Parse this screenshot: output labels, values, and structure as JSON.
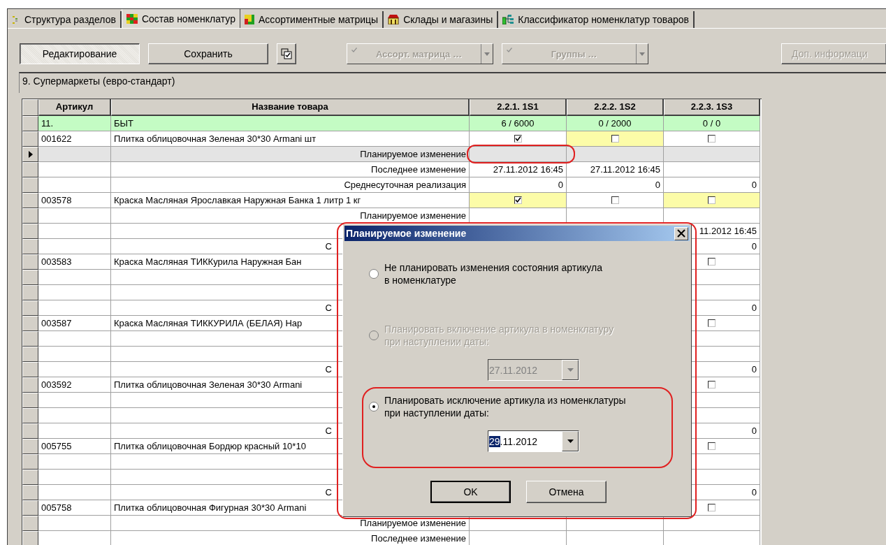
{
  "tabs": [
    {
      "label": "Структура разделов",
      "selected": false
    },
    {
      "label": "Состав номенклатур",
      "selected": true
    },
    {
      "label": "Ассортиментные матрицы",
      "selected": false
    },
    {
      "label": "Склады и магазины",
      "selected": false
    },
    {
      "label": "Классификатор номенклатур товаров",
      "selected": false
    }
  ],
  "toolbar": [
    {
      "kind": "toggle",
      "label": "Редактирование",
      "pressed": true
    },
    {
      "kind": "button",
      "label": "Сохранить",
      "disabled": false
    },
    {
      "kind": "icon"
    },
    {
      "kind": "dropdown",
      "label": "Ассорт. матрица …",
      "disabled": true
    },
    {
      "kind": "dropdown",
      "label": "Группы …",
      "disabled": true
    },
    {
      "kind": "button",
      "label": "Доп. информаци",
      "disabled": true
    }
  ],
  "breadcrumb": "9. Супермаркеты (евро-стандарт)",
  "table": {
    "columns": [
      "",
      "Артикул",
      "Название товара",
      "2.2.1. 1S1",
      "2.2.2. 1S2",
      "2.2.3. 1S3"
    ],
    "rows": [
      {
        "kind": "group",
        "selected": false,
        "cells": [
          null,
          {
            "text": "11."
          },
          {
            "text": "БЫТ"
          },
          {
            "text": "6 / 6000"
          },
          {
            "text": "0 / 2000"
          },
          {
            "text": "0 / 0"
          }
        ]
      },
      {
        "kind": "item",
        "selected": false,
        "cells": [
          null,
          {
            "text": "001622"
          },
          {
            "text": "Плитка облицовочная Зеленая 30*30 Armani шт"
          },
          {
            "checked": true,
            "highlighted": false
          },
          {
            "checked": false,
            "highlighted": true
          },
          {
            "checked": false,
            "highlighted": false
          }
        ]
      },
      {
        "kind": "detail",
        "selected": true,
        "cells": [
          null,
          null,
          {
            "text": "Планируемое изменение"
          },
          null,
          null,
          null
        ]
      },
      {
        "kind": "detail",
        "selected": false,
        "cells": [
          null,
          null,
          {
            "text": "Последнее изменение"
          },
          {
            "text": "27.11.2012 16:45"
          },
          {
            "text": "27.11.2012 16:45"
          },
          null
        ]
      },
      {
        "kind": "detail",
        "selected": false,
        "cells": [
          null,
          null,
          {
            "text": "Среднесуточная реализация"
          },
          {
            "text": "0"
          },
          {
            "text": "0"
          },
          {
            "text": "0"
          }
        ]
      },
      {
        "kind": "item",
        "selected": false,
        "cells": [
          null,
          {
            "text": "003578"
          },
          {
            "text": "Краска Масляная Ярославкая Наружная Банка 1 литр 1 кг"
          },
          {
            "checked": true,
            "highlighted": true
          },
          {
            "checked": false,
            "highlighted": false
          },
          {
            "checked": false,
            "highlighted": true
          }
        ]
      },
      {
        "kind": "detail",
        "selected": false,
        "cells": [
          null,
          null,
          {
            "text": "Планируемое изменение"
          },
          null,
          null,
          null
        ]
      },
      {
        "kind": "detail",
        "selected": false,
        "cells": [
          null,
          null,
          null,
          null,
          null,
          {
            "text": "11.2012 16:45"
          }
        ]
      },
      {
        "kind": "detail",
        "selected": false,
        "cells": [
          null,
          null,
          {
            "text": "С"
          },
          null,
          null,
          {
            "text": "0"
          }
        ]
      },
      {
        "kind": "item",
        "selected": false,
        "cells": [
          null,
          {
            "text": "003583"
          },
          {
            "text": "Краска Масляная ТИККурила Наружная Бан"
          },
          null,
          null,
          {
            "checked": false,
            "highlighted": false
          }
        ]
      },
      {
        "kind": "detail",
        "selected": false,
        "cells": [
          null,
          null,
          null,
          null,
          null,
          null
        ]
      },
      {
        "kind": "detail",
        "selected": false,
        "cells": [
          null,
          null,
          null,
          null,
          null,
          null
        ]
      },
      {
        "kind": "detail",
        "selected": false,
        "cells": [
          null,
          null,
          {
            "text": "С"
          },
          null,
          null,
          {
            "text": "0"
          }
        ]
      },
      {
        "kind": "item",
        "selected": false,
        "cells": [
          null,
          {
            "text": "003587"
          },
          {
            "text": "Краска Масляная ТИККУРИЛА (БЕЛАЯ) Нар"
          },
          null,
          null,
          {
            "checked": false,
            "highlighted": false
          }
        ]
      },
      {
        "kind": "detail",
        "selected": false,
        "cells": [
          null,
          null,
          null,
          null,
          null,
          null
        ]
      },
      {
        "kind": "detail",
        "selected": false,
        "cells": [
          null,
          null,
          null,
          null,
          null,
          null
        ]
      },
      {
        "kind": "detail",
        "selected": false,
        "cells": [
          null,
          null,
          {
            "text": "С"
          },
          null,
          null,
          {
            "text": "0"
          }
        ]
      },
      {
        "kind": "item",
        "selected": false,
        "cells": [
          null,
          {
            "text": "003592"
          },
          {
            "text": "Плитка облицовочная Зеленая 30*30 Armani"
          },
          null,
          null,
          {
            "checked": false,
            "highlighted": false
          }
        ]
      },
      {
        "kind": "detail",
        "selected": false,
        "cells": [
          null,
          null,
          null,
          null,
          null,
          null
        ]
      },
      {
        "kind": "detail",
        "selected": false,
        "cells": [
          null,
          null,
          null,
          null,
          null,
          null
        ]
      },
      {
        "kind": "detail",
        "selected": false,
        "cells": [
          null,
          null,
          {
            "text": "С"
          },
          null,
          null,
          {
            "text": "0"
          }
        ]
      },
      {
        "kind": "item",
        "selected": false,
        "cells": [
          null,
          {
            "text": "005755"
          },
          {
            "text": "Плитка облицовочная Бордюр красный 10*10"
          },
          null,
          null,
          {
            "checked": false,
            "highlighted": false
          }
        ]
      },
      {
        "kind": "detail",
        "selected": false,
        "cells": [
          null,
          null,
          null,
          null,
          null,
          null
        ]
      },
      {
        "kind": "detail",
        "selected": false,
        "cells": [
          null,
          null,
          null,
          null,
          null,
          null
        ]
      },
      {
        "kind": "detail",
        "selected": false,
        "cells": [
          null,
          null,
          {
            "text": "С"
          },
          null,
          null,
          {
            "text": "0"
          }
        ]
      },
      {
        "kind": "item",
        "selected": false,
        "cells": [
          null,
          {
            "text": "005758"
          },
          {
            "text": "Плитка облицовочная Фигурная 30*30 Armani"
          },
          null,
          null,
          {
            "checked": false,
            "highlighted": false
          }
        ]
      },
      {
        "kind": "detail",
        "selected": false,
        "cells": [
          null,
          null,
          {
            "text": "Планируемое изменение"
          },
          null,
          null,
          null
        ]
      },
      {
        "kind": "detail",
        "selected": false,
        "cells": [
          null,
          null,
          {
            "text": "Последнее изменение"
          },
          null,
          null,
          null
        ]
      }
    ]
  },
  "dialog": {
    "title": "Планируемое изменение",
    "options": [
      {
        "label": "Не планировать изменения состояния артикула\nв номенклатуре",
        "selected": false,
        "disabled": false
      },
      {
        "label": "Планировать включение артикула в номенклатуру\nпри наступлении даты:",
        "selected": false,
        "disabled": true,
        "date": {
          "value": "27.11.2012"
        }
      },
      {
        "label": "Планировать исключение артикула из номенклатуры\nпри наступлении даты:",
        "selected": true,
        "disabled": false,
        "date": {
          "selected_part": "29",
          "value": ".11.2012"
        }
      }
    ],
    "buttons": [
      "OK",
      "Отмена"
    ]
  }
}
